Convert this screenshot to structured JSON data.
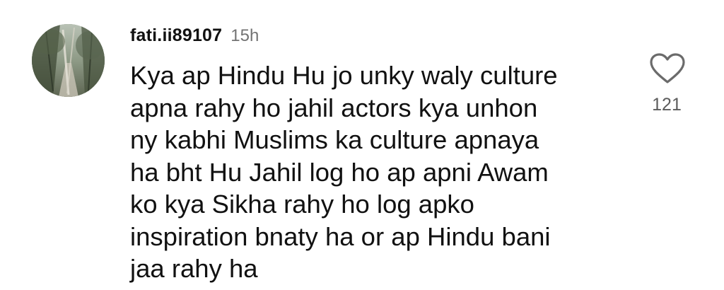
{
  "comment": {
    "username": "fati.ii89107",
    "timestamp": "15h",
    "text": "Kya ap Hindu Hu jo unky waly culture\napna rahy ho jahil actors kya unhon\nny kabhi Muslims ka culture apnaya\nha bht Hu Jahil log ho ap apni Awam\nko kya Sikha rahy ho log apko\ninspiration bnaty ha or ap Hindu bani\njaa rahy ha",
    "like_count": "121",
    "like_icon": "heart-outline-icon",
    "avatar_icon": "profile-photo-trees-path"
  },
  "colors": {
    "text": "#111111",
    "muted": "#737373",
    "count": "#5c5c5c",
    "background": "#ffffff"
  }
}
